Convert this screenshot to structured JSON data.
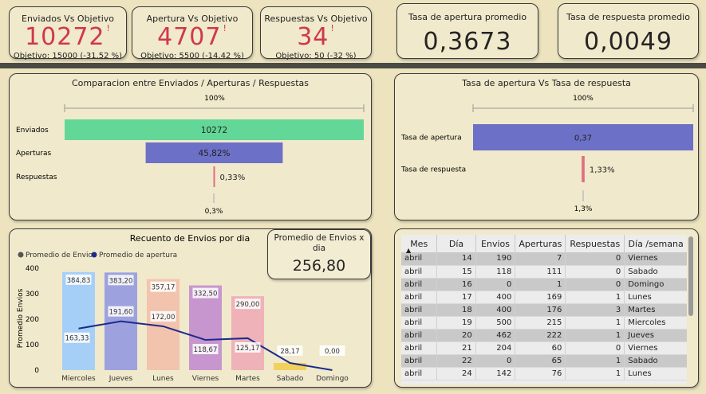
{
  "kpis": [
    {
      "title": "Enviados Vs Objetivo",
      "value": "10272",
      "flag": "!",
      "sub": "Objetivo: 15000 (-31.52 %)"
    },
    {
      "title": "Apertura Vs Objetivo",
      "value": "4707",
      "flag": "!",
      "sub": "Objetivo: 5500 (-14.42 %)"
    },
    {
      "title": "Respuestas Vs Objetivo",
      "value": "34",
      "flag": "!",
      "sub": "Objetivo: 50 (-32 %)"
    }
  ],
  "rates": [
    {
      "title": "Tasa de apertura promedio",
      "value": "0,3673"
    },
    {
      "title": "Tasa de respuesta promedio",
      "value": "0,0049"
    }
  ],
  "funnel": {
    "title": "Comparacion entre Enviados / Aperturas / Respuestas",
    "top_label": "100%",
    "rows": [
      {
        "label": "Enviados",
        "value_label": "10272",
        "pct": 100,
        "color": "#63d797"
      },
      {
        "label": "Aperturas",
        "value_label": "45,82%",
        "pct": 45.82,
        "color": "#6d70c7"
      },
      {
        "label": "Respuestas",
        "value_label": "0,33%",
        "pct": 0.33,
        "color": "#e06f82"
      }
    ],
    "bottom_label": "0,3%"
  },
  "rate_funnel": {
    "title": "Tasa de apertura Vs Tasa de respuesta",
    "top_label": "100%",
    "rows": [
      {
        "label": "Tasa de apertura",
        "value_label": "0,37",
        "pct": 100,
        "color": "#6d70c7"
      },
      {
        "label": "Tasa de respuesta",
        "value_label": "1,33%",
        "pct": 1.33,
        "color": "#e06f82"
      }
    ],
    "bottom_label": "1,3%"
  },
  "avg_card": {
    "title": "Promedio de Envios x dia",
    "value": "256,80"
  },
  "chart_data": {
    "type": "bar",
    "title": "Recuento de Envios por dia",
    "ylabel": "Promedio Envios",
    "xlabel": "",
    "ylim": [
      0,
      400
    ],
    "yticks": [
      0,
      100,
      200,
      300,
      400
    ],
    "categories": [
      "Miercoles",
      "Jueves",
      "Lunes",
      "Viernes",
      "Martes",
      "Sabado",
      "Domingo"
    ],
    "bar_colors": [
      "#a5cff7",
      "#9da2de",
      "#f3c4ad",
      "#c796cf",
      "#eeb2b8",
      "#f2d05c",
      "#e8e8e8"
    ],
    "legend": [
      "Promedio de Envios",
      "Promedio de apertura"
    ],
    "legend_colors": [
      "#555555",
      "#1e2a8a"
    ],
    "series": [
      {
        "name": "Promedio de Envios",
        "type": "bar",
        "values": [
          384.83,
          383.2,
          357.17,
          332.5,
          290.0,
          28.17,
          0.0
        ],
        "labels": [
          "384,83",
          "383,20",
          "357,17",
          "332,50",
          "290,00",
          "28,17",
          "0,00"
        ]
      },
      {
        "name": "Promedio de apertura",
        "type": "line",
        "values": [
          163.33,
          191.6,
          172.0,
          118.67,
          125.17,
          28.17,
          0.0
        ],
        "labels": [
          "163,33",
          "191,60",
          "172,00",
          "118,67",
          "125,17",
          "",
          ""
        ]
      }
    ]
  },
  "table": {
    "headers": [
      "Mes",
      "Día",
      "Envios",
      "Aperturas",
      "Respuestas",
      "Día /semana"
    ],
    "rows": [
      [
        "abril",
        "14",
        "190",
        "7",
        "0",
        "Viernes"
      ],
      [
        "abril",
        "15",
        "118",
        "111",
        "0",
        "Sabado"
      ],
      [
        "abril",
        "16",
        "0",
        "1",
        "0",
        "Domingo"
      ],
      [
        "abril",
        "17",
        "400",
        "169",
        "1",
        "Lunes"
      ],
      [
        "abril",
        "18",
        "400",
        "176",
        "3",
        "Martes"
      ],
      [
        "abril",
        "19",
        "500",
        "215",
        "1",
        "Miercoles"
      ],
      [
        "abril",
        "20",
        "462",
        "222",
        "1",
        "Jueves"
      ],
      [
        "abril",
        "21",
        "204",
        "60",
        "0",
        "Viernes"
      ],
      [
        "abril",
        "22",
        "0",
        "65",
        "1",
        "Sabado"
      ],
      [
        "abril",
        "24",
        "142",
        "76",
        "1",
        "Lunes"
      ]
    ]
  }
}
